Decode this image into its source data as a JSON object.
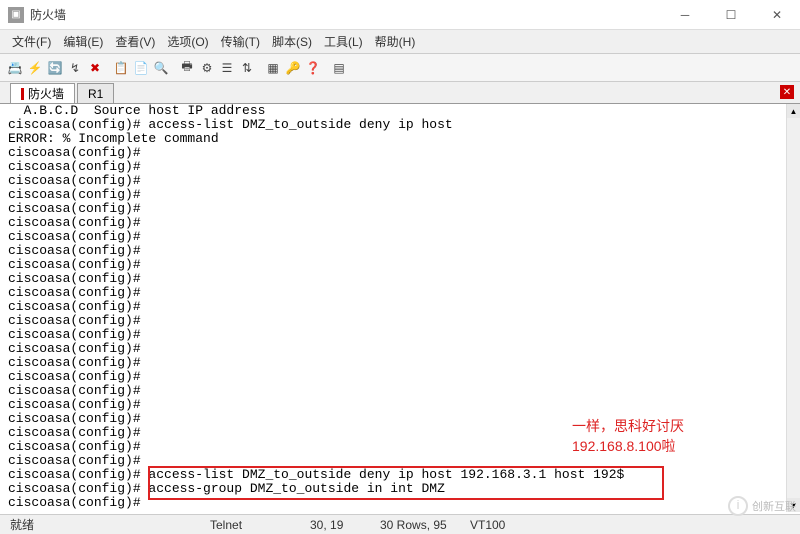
{
  "window": {
    "title": "防火墙"
  },
  "menu": {
    "file": "文件(F)",
    "edit": "编辑(E)",
    "view": "查看(V)",
    "options": "选项(O)",
    "transfer": "传输(T)",
    "script": "脚本(S)",
    "tools": "工具(L)",
    "help": "帮助(H)"
  },
  "tabs": {
    "firewall": "防火墙",
    "r1": "R1"
  },
  "terminal_lines": [
    "  A.B.C.D  Source host IP address",
    "ciscoasa(config)# access-list DMZ_to_outside deny ip host",
    "ERROR: % Incomplete command",
    "ciscoasa(config)#",
    "ciscoasa(config)#",
    "ciscoasa(config)#",
    "ciscoasa(config)#",
    "ciscoasa(config)#",
    "ciscoasa(config)#",
    "ciscoasa(config)#",
    "ciscoasa(config)#",
    "ciscoasa(config)#",
    "ciscoasa(config)#",
    "ciscoasa(config)#",
    "ciscoasa(config)#",
    "ciscoasa(config)#",
    "ciscoasa(config)#",
    "ciscoasa(config)#",
    "ciscoasa(config)#",
    "ciscoasa(config)#",
    "ciscoasa(config)#",
    "ciscoasa(config)#",
    "ciscoasa(config)#",
    "ciscoasa(config)#",
    "ciscoasa(config)#",
    "ciscoasa(config)#",
    "ciscoasa(config)# access-list DMZ_to_outside deny ip host 192.168.3.1 host 192$",
    "ciscoasa(config)# access-group DMZ_to_outside in int DMZ",
    "ciscoasa(config)#"
  ],
  "annotation": {
    "line1": "一样，思科好讨厌",
    "line2": "192.168.8.100啦"
  },
  "status": {
    "ready": "就绪",
    "protocol": "Telnet",
    "pos": "30, 19",
    "rows": "30 Rows, 95",
    "term": "VT100"
  },
  "watermark": "创新互联"
}
